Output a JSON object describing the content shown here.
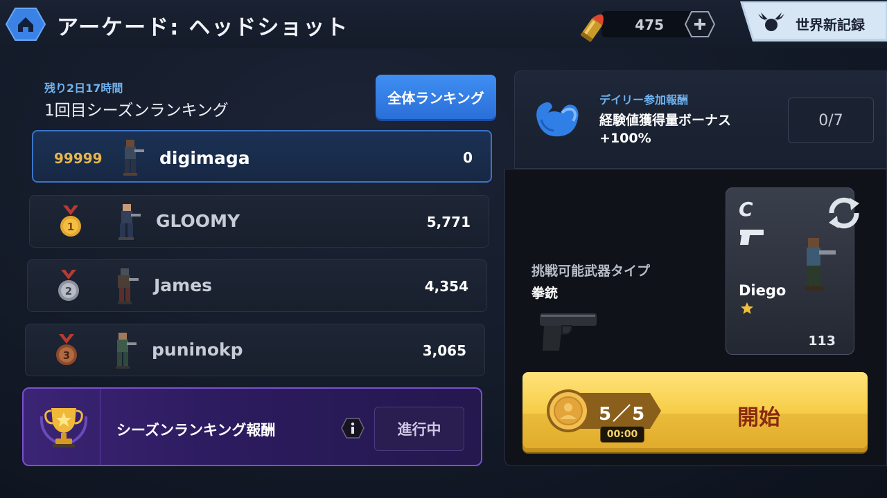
{
  "header": {
    "title": "アーケード: ヘッドショット",
    "ammo": "475",
    "record_label": "世界新記録"
  },
  "ranking": {
    "time_left": "残り2日17時間",
    "season_title": "1回目シーズンランキング",
    "overall_button": "全体ランキング",
    "self_row": {
      "rank": "99999",
      "name": "digimaga",
      "score": "0"
    },
    "rows": [
      {
        "rank": "1",
        "name": "GLOOMY",
        "score": "5,771",
        "medal_color": "#e2a72e"
      },
      {
        "rank": "2",
        "name": "James",
        "score": "4,354",
        "medal_color": "#9aa1ad"
      },
      {
        "rank": "3",
        "name": "puninokp",
        "score": "3,065",
        "medal_color": "#a25a34"
      }
    ],
    "reward": {
      "label": "シーズンランキング報酬",
      "status": "進行中"
    }
  },
  "daily": {
    "title": "デイリー参加報酬",
    "description": "経験値獲得量ボーナス",
    "bonus": "+100%",
    "counter": "0/7"
  },
  "battle": {
    "weapon_type_label": "挑戦可能武器タイプ",
    "weapon_name": "拳銃",
    "character": {
      "class": "C",
      "name": "Diego",
      "power": "113",
      "stars": 1
    },
    "start": {
      "tokens": "5／5",
      "timer": "00:00",
      "label": "開始"
    }
  },
  "colors": {
    "accent_blue": "#3f8ff2",
    "gold": "#f7cf4c",
    "purple": "#7b4fd0"
  }
}
